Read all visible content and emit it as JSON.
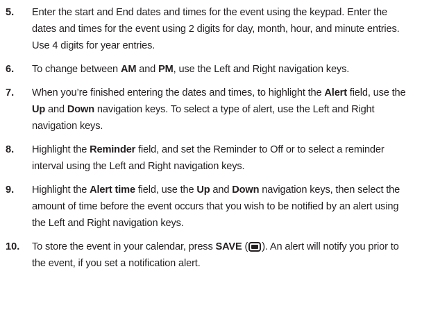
{
  "steps": [
    {
      "number": "5.",
      "text": "Enter the start and End dates and times for the event using the keypad. Enter the dates and times for the event using 2 digits for day, month, hour, and minute entries. Use 4 digits for year entries."
    },
    {
      "number": "6.",
      "parts": [
        "To change between ",
        "AM",
        " and ",
        "PM",
        ", use the Left and Right navigation keys."
      ]
    },
    {
      "number": "7.",
      "parts": [
        "When you’re finished entering the dates and times, to highlight the ",
        "Alert",
        " field, use the ",
        "Up",
        " and ",
        "Down",
        " navigation keys. To select a type of alert, use the Left and Right navigation keys."
      ]
    },
    {
      "number": "8.",
      "parts": [
        "Highlight the ",
        "Reminder",
        " field, and set the Reminder to Off or to select a reminder interval using the Left and Right navigation keys."
      ]
    },
    {
      "number": "9.",
      "parts": [
        "Highlight the ",
        "Alert time",
        " field, use the ",
        "Up",
        " and ",
        "Down",
        " navigation keys, then select the amount of time before the event occurs that you wish to be notified by an alert using the Left and Right navigation keys."
      ]
    },
    {
      "number": "10.",
      "parts": [
        "To store the event in your calendar, press ",
        "SAVE",
        " (",
        ").",
        " An alert will notify you prior to the event, if you set a notification alert."
      ],
      "icon": "softkey-icon"
    }
  ]
}
